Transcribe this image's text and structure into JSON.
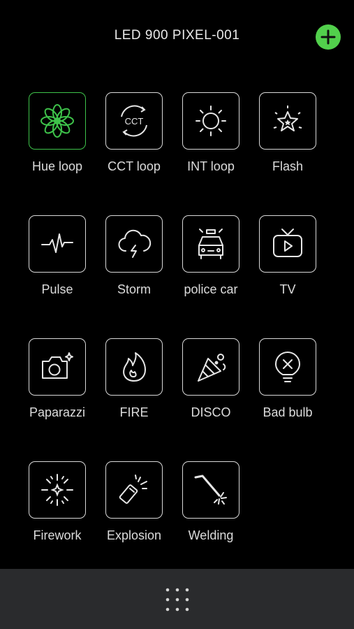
{
  "header": {
    "title": "LED 900 PIXEL-001",
    "add_icon": "plus-circle-icon",
    "add_color": "#52d04c"
  },
  "accent_active": "#3ec24a",
  "effects": [
    {
      "label": "Hue loop",
      "icon": "flower-icon",
      "active": true
    },
    {
      "label": "CCT loop",
      "icon": "cct-icon",
      "active": false
    },
    {
      "label": "INT loop",
      "icon": "sun-icon",
      "active": false
    },
    {
      "label": "Flash",
      "icon": "star-burst-icon",
      "active": false
    },
    {
      "label": "Pulse",
      "icon": "heartbeat-icon",
      "active": false
    },
    {
      "label": "Storm",
      "icon": "storm-cloud-icon",
      "active": false
    },
    {
      "label": "police car",
      "icon": "police-car-icon",
      "active": false
    },
    {
      "label": "TV",
      "icon": "tv-icon",
      "active": false
    },
    {
      "label": "Paparazzi",
      "icon": "camera-icon",
      "active": false
    },
    {
      "label": "FIRE",
      "icon": "flame-icon",
      "active": false
    },
    {
      "label": "DISCO",
      "icon": "party-popper-icon",
      "active": false
    },
    {
      "label": "Bad bulb",
      "icon": "broken-bulb-icon",
      "active": false
    },
    {
      "label": "Firework",
      "icon": "firework-icon",
      "active": false
    },
    {
      "label": "Explosion",
      "icon": "explosion-icon",
      "active": false
    },
    {
      "label": "Welding",
      "icon": "welding-icon",
      "active": false
    }
  ],
  "bottom_bar": {
    "menu_icon": "grid-dots-icon"
  }
}
